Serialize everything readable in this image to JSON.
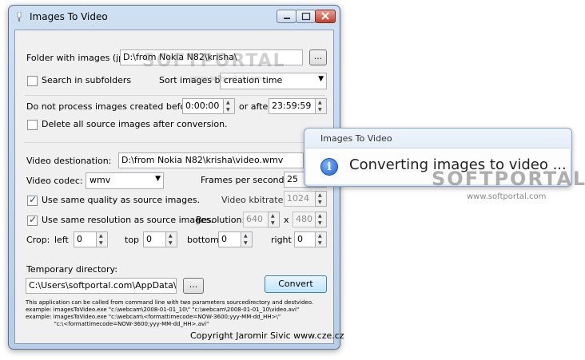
{
  "window": {
    "title": "Images To Video"
  },
  "form": {
    "folder_label": "Folder with images (jpg):",
    "folder_value": "D:\\from Nokia N82\\krisha\\",
    "browse_label": "...",
    "search_sub_label": "Search in subfolders",
    "search_sub_checked": false,
    "sort_label": "Sort images by:",
    "sort_value": "creation time",
    "not_before_label": "Do not process images created before:",
    "before_value": "0:00:00",
    "after_label": "or after",
    "after_value": "23:59:59",
    "delete_label": "Delete all source images after conversion.",
    "delete_checked": false,
    "dest_label": "Video destionation:",
    "dest_value": "D:\\from Nokia N82\\krisha\\video.wmv",
    "codec_label": "Video codec:",
    "codec_value": "wmv",
    "fps_label": "Frames per second:",
    "fps_value": "25",
    "same_quality_label": "Use same quality as source images.",
    "same_quality_checked": true,
    "kbitrate_label": "Video kbitrate:",
    "kbitrate_value": "1024",
    "same_res_label": "Use same resolution as source images.",
    "same_res_checked": true,
    "resolution_label": "Resolution:",
    "res_w": "640",
    "res_x": "x",
    "res_h": "480",
    "crop_label": "Crop:",
    "crop_left_label": "left",
    "crop_left": "0",
    "crop_top_label": "top",
    "crop_top": "0",
    "crop_bottom_label": "bottom",
    "crop_bottom": "0",
    "crop_right_label": "right",
    "crop_right": "0",
    "temp_label": "Temporary directory:",
    "temp_value": "C:\\Users\\softportal.com\\AppData\\Loc",
    "convert_label": "Convert",
    "help_lines": "This application can be called from command line with two parameters sourcedirectory and destvideo.\nexample: imagesToVideo.exe \"c:\\webcam\\2008-01-01_10\\\" \"c:\\webcam\\2008-01-01_10\\video.avi\"\nexample: imagesToVideo.exe \"c:\\webcam\\<formattimecode=NOW-3600;yyy-MM-dd_HH>\\\"\n                \"c:\\<formattimecode=NOW-3600;yyy-MM-dd_HH>.avi\"",
    "copyright": "Copyright Jaromir Sivic www.cze.cz"
  },
  "popup": {
    "title": "Images To Video",
    "message": "Converting images to video ..."
  },
  "watermark": {
    "brand": "SOFTPORTAL",
    "url": "www.softportal.com"
  }
}
